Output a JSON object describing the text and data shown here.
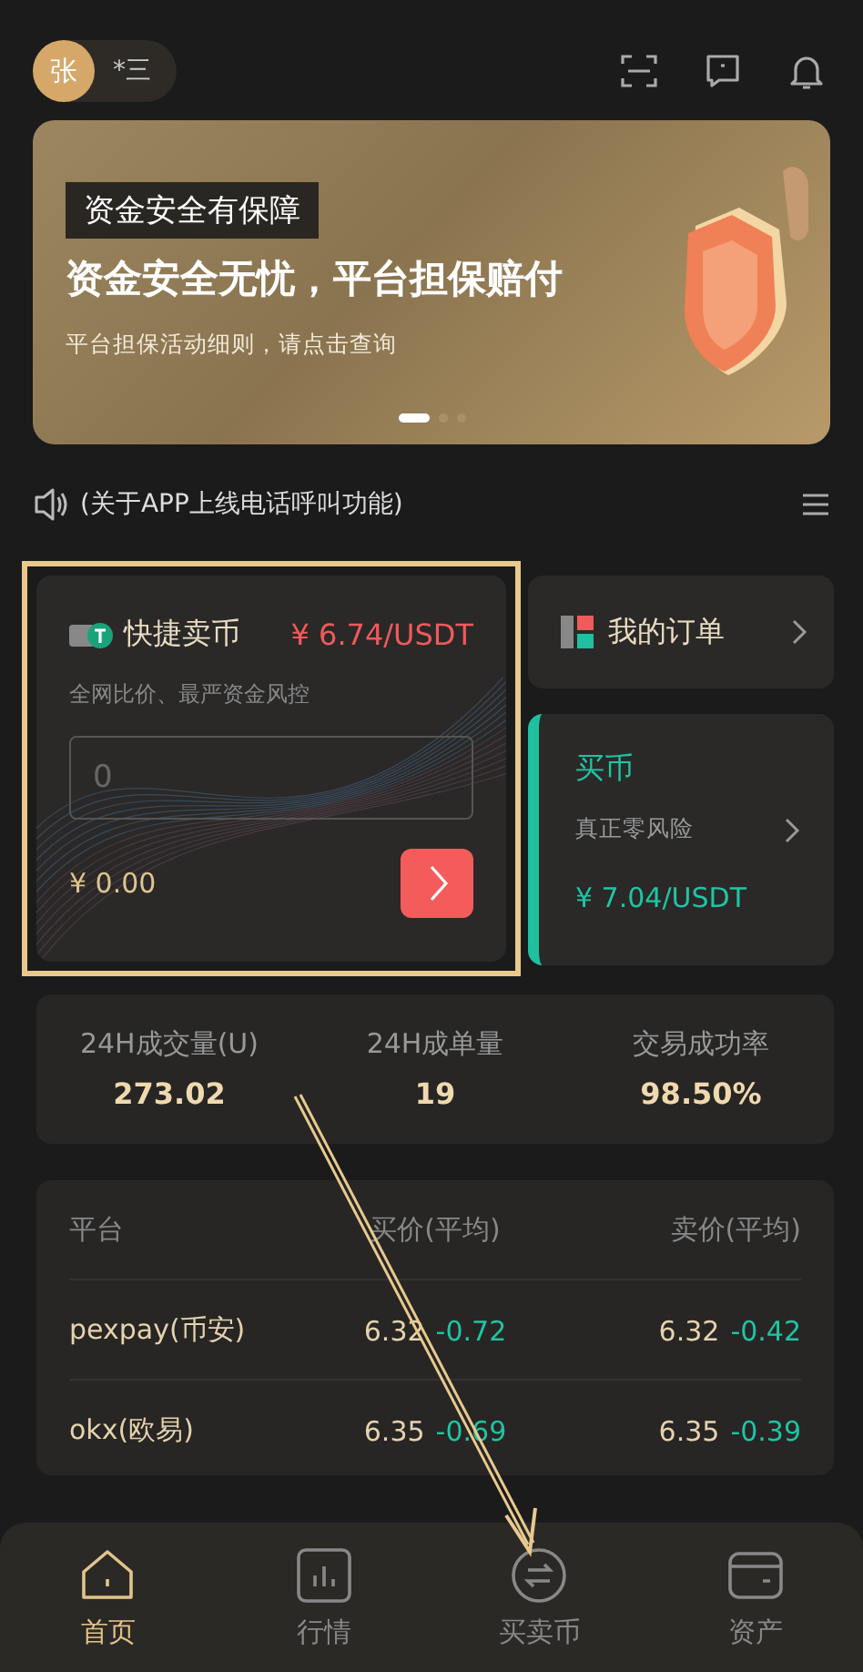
{
  "header": {
    "avatar": "张",
    "username": "*三"
  },
  "banner": {
    "tag": "资金安全有保障",
    "headline": "资金安全无忧，平台担保赔付",
    "subline": "平台担保活动细则，请点击查询",
    "dots": [
      {
        "selected": true
      },
      {
        "selected": false
      },
      {
        "selected": false
      }
    ]
  },
  "notice": {
    "text": "(关于APP上线电话呼叫功能)"
  },
  "quick_sell": {
    "title": "快捷卖币",
    "price": "¥ 6.74/USDT",
    "subtitle": "全网比价、最严资金风控",
    "amount_field": {
      "placeholder": "0"
    },
    "total": "¥ 0.00",
    "highlighted": true
  },
  "my_orders": {
    "label": "我的订单"
  },
  "buy": {
    "title": "买币",
    "subtitle": "真正零风险",
    "price": "¥ 7.04/USDT"
  },
  "stats": [
    {
      "label": "24H成交量(U)",
      "value": "273.02"
    },
    {
      "label": "24H成单量",
      "value": "19"
    },
    {
      "label": "交易成功率",
      "value": "98.50%"
    }
  ],
  "market": {
    "columns": [
      "平台",
      "买价(平均)",
      "卖价(平均)"
    ],
    "rows": [
      {
        "platform": "pexpay(币安)",
        "buy_price": "6.32",
        "buy_change": "-0.72",
        "sell_price": "6.32",
        "sell_change": "-0.42"
      },
      {
        "platform": "okx(欧易)",
        "buy_price": "6.35",
        "buy_change": "-0.69",
        "sell_price": "6.35",
        "sell_change": "-0.39"
      }
    ]
  },
  "nav": [
    {
      "label": "首页",
      "kind": "home",
      "selected": true
    },
    {
      "label": "行情",
      "kind": "chart",
      "selected": false
    },
    {
      "label": "买卖币",
      "kind": "swap",
      "selected": false
    },
    {
      "label": "资产",
      "kind": "wallet",
      "selected": false
    }
  ]
}
